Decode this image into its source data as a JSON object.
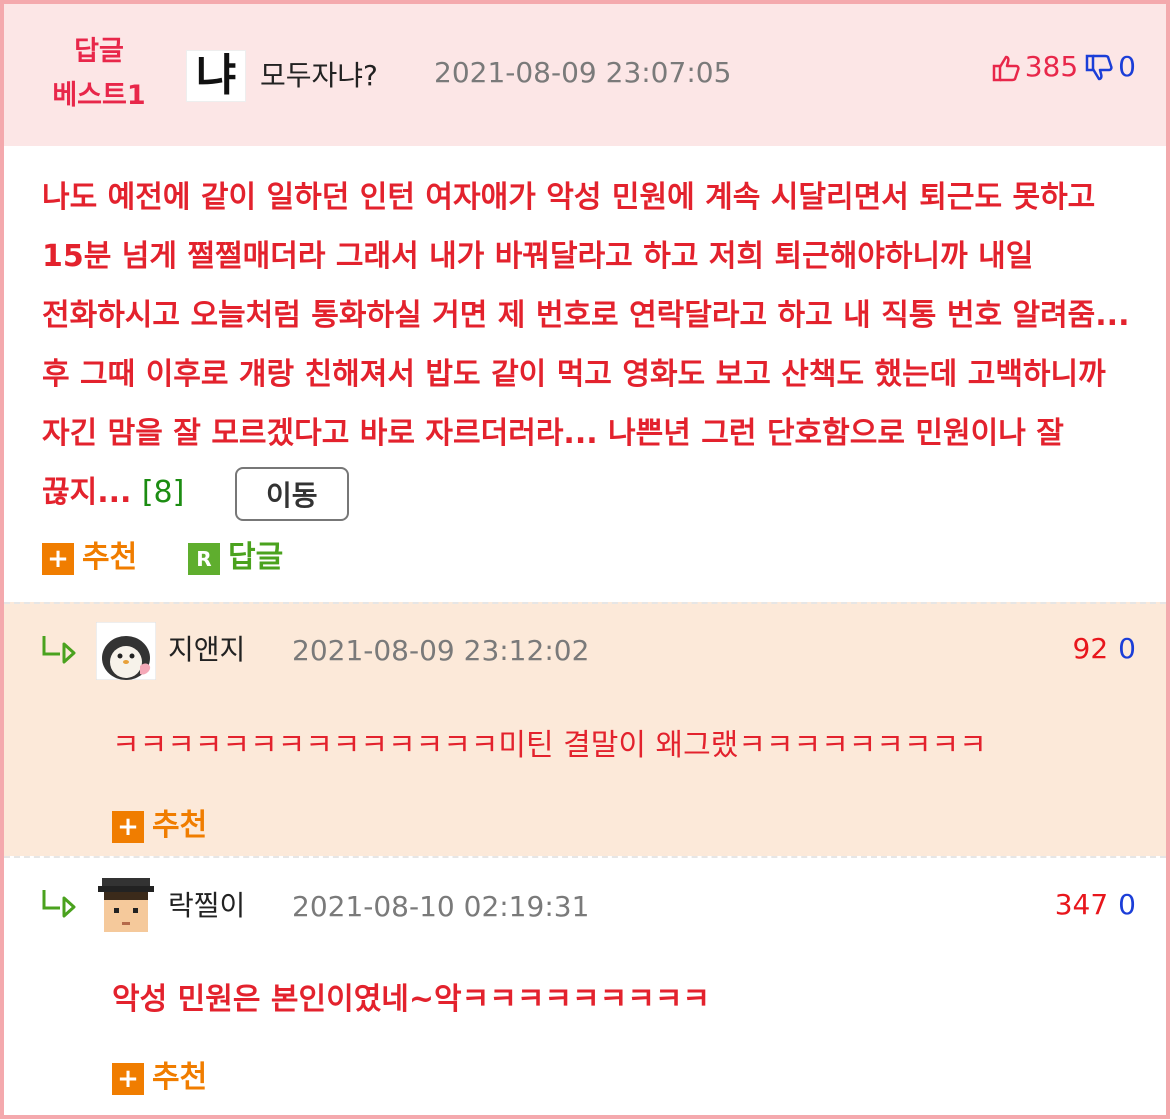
{
  "best_comment": {
    "badge_line1": "답글",
    "badge_line2": "베스트1",
    "nickname_image_text": "냐",
    "author": "모두자냐?",
    "date": "2021-08-09 23:07:05",
    "upvotes": "385",
    "downvotes": "0",
    "body": "나도 예전에 같이 일하던 인턴 여자애가 악성 민원에 계속 시달리면서 퇴근도 못하고 15분 넘게 쩔쩔매더라 그래서 내가 바꿔달라고 하고 저희 퇴근해야하니까 내일 전화하시고 오늘처럼 통화하실 거면 제 번호로 연락달라고 하고 내 직통 번호 알려줌... 후 그때 이후로 걔랑 친해져서 밥도 같이 먹고 영화도 보고 산책도 했는데 고백하니까 자긴 맘을 잘 모르겠다고 바로 자르더러라... 나쁜년 그런 단호함으로 민원이나 잘 끊지...",
    "reply_count": "[8]",
    "move_button": "이동",
    "recommend_label": "추천",
    "reply_label": "답글",
    "recommend_icon": "+",
    "reply_icon": "R"
  },
  "replies": [
    {
      "author": "지앤지",
      "date": "2021-08-09 23:12:02",
      "upvotes": "92",
      "downvotes": "0",
      "text": "ㅋㅋㅋㅋㅋㅋㅋㅋㅋㅋㅋㅋㅋㅋ미틴 결말이 왜그랬ㅋㅋㅋㅋㅋㅋㅋㅋㅋ",
      "recommend_label": "추천",
      "recommend_icon": "+"
    },
    {
      "author": "락찔이",
      "date": "2021-08-10 02:19:31",
      "upvotes": "347",
      "downvotes": "0",
      "text": "악성 민원은 본인이였네~악ㅋㅋㅋㅋㅋㅋㅋㅋㅋ",
      "recommend_label": "추천",
      "recommend_icon": "+"
    }
  ],
  "colors": {
    "accent_red": "#e3222d",
    "best_bg": "#fce6e6",
    "reply_bg": "#fce9d9",
    "frame_border": "#f4a9ad",
    "recommend_orange": "#f07d00",
    "reply_green": "#5fae2e",
    "down_blue": "#1b3ed8"
  },
  "icons": [
    "thumbs-up-icon",
    "thumbs-down-icon",
    "reply-arrow-icon",
    "penguin-avatar",
    "pixel-boy-avatar",
    "plus-icon",
    "r-icon"
  ]
}
